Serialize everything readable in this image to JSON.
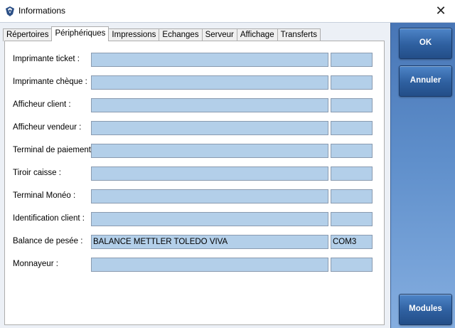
{
  "window": {
    "title": "Informations",
    "icon": "app-logo-icon",
    "close_glyph": "✕"
  },
  "tabs": [
    {
      "label": "Répertoires",
      "active": false
    },
    {
      "label": "Périphériques",
      "active": true
    },
    {
      "label": "Impressions",
      "active": false
    },
    {
      "label": "Echanges",
      "active": false
    },
    {
      "label": "Serveur",
      "active": false
    },
    {
      "label": "Affichage",
      "active": false
    },
    {
      "label": "Transferts",
      "active": false
    }
  ],
  "rows": [
    {
      "label": "Imprimante ticket :",
      "value": "",
      "port": ""
    },
    {
      "label": "Imprimante chèque :",
      "value": "",
      "port": ""
    },
    {
      "label": "Afficheur client :",
      "value": "",
      "port": ""
    },
    {
      "label": "Afficheur vendeur :",
      "value": "",
      "port": ""
    },
    {
      "label": "Terminal de paiement :",
      "value": "",
      "port": ""
    },
    {
      "label": "Tiroir caisse :",
      "value": "",
      "port": ""
    },
    {
      "label": "Terminal Monéo :",
      "value": "",
      "port": ""
    },
    {
      "label": "Identification client :",
      "value": "",
      "port": ""
    },
    {
      "label": "Balance de pesée :",
      "value": "BALANCE METTLER TOLEDO VIVA",
      "port": "COM3"
    },
    {
      "label": "Monnayeur :",
      "value": "",
      "port": ""
    }
  ],
  "buttons": {
    "ok": "OK",
    "cancel": "Annuler",
    "modules": "Modules"
  },
  "colors": {
    "field_bg": "#b3cfe9",
    "sidebar_top": "#4876b6",
    "button": "#2e5f9f"
  }
}
